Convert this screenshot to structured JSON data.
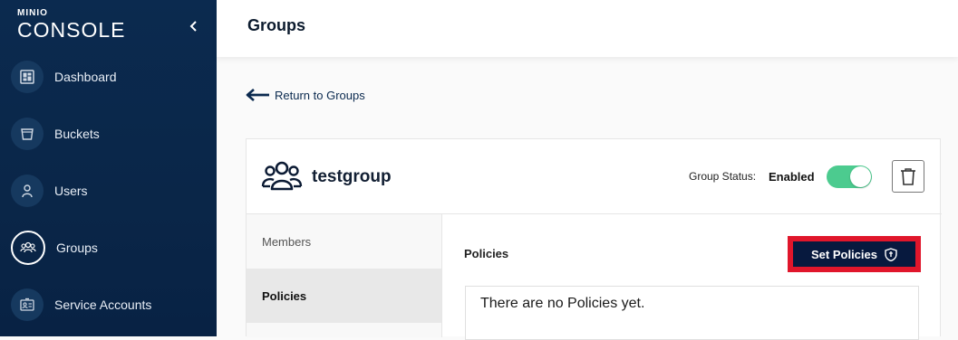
{
  "brand": {
    "small": "MINIO",
    "main": "CONSOLE"
  },
  "sidebar": {
    "items": [
      {
        "label": "Dashboard",
        "icon": "dashboard-icon"
      },
      {
        "label": "Buckets",
        "icon": "bucket-icon"
      },
      {
        "label": "Users",
        "icon": "user-icon"
      },
      {
        "label": "Groups",
        "icon": "groups-icon",
        "active": true
      },
      {
        "label": "Service Accounts",
        "icon": "service-accounts-icon"
      }
    ]
  },
  "header": {
    "title": "Groups"
  },
  "back_link": {
    "label": "Return to Groups"
  },
  "group": {
    "name": "testgroup",
    "status_label": "Group Status:",
    "status_value": "Enabled",
    "enabled": true
  },
  "tabs": [
    {
      "label": "Members",
      "active": false
    },
    {
      "label": "Policies",
      "active": true
    }
  ],
  "policies_panel": {
    "title": "Policies",
    "set_button": "Set Policies",
    "empty_message": "There are no Policies yet."
  },
  "colors": {
    "sidebar_bg": "#0b2a4f",
    "toggle_on": "#4ccb8f",
    "button_bg": "#07193e",
    "highlight": "#e0162b"
  }
}
